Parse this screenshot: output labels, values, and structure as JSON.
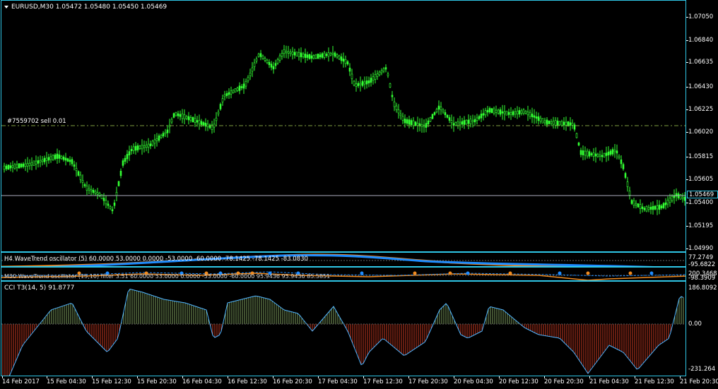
{
  "main": {
    "header": "EURUSD,M30  1.05472 1.05480 1.05450 1.05469",
    "order_line_label": "#7559702 sell 0.01",
    "current_price": "1.05469",
    "price_ticks": [
      "1.07050",
      "1.06840",
      "1.06635",
      "1.06430",
      "1.06225",
      "1.06020",
      "1.05815",
      "1.05605",
      "1.05400",
      "1.05195",
      "1.04990"
    ]
  },
  "wavetrend_h4": {
    "label": "H4 WaveTrend oscillator (5) 60.0000 53.0000 0.0000 -53.0000 -60.0000 -78.1425 -78.1425 -83.0830",
    "ticks": [
      "77.2749",
      "-95.6822"
    ]
  },
  "wavetrend_m30": {
    "label": "M30 WaveTrend oscillator (15,10) filter 3.51 60.0000 53.0000 0.0000 -53.0000 -60.0000 95.9436 95.9436 85.5851",
    "ticks": [
      "200.3468",
      "-98.3909"
    ]
  },
  "cci": {
    "label": "CCI T3(14, 5) 91.8777",
    "ticks": [
      "186.8092",
      "0.00",
      "-231.264"
    ]
  },
  "time_labels": [
    "14 Feb 2017",
    "15 Feb 04:30",
    "15 Feb 12:30",
    "15 Feb 20:30",
    "16 Feb 04:30",
    "16 Feb 12:30",
    "16 Feb 20:30",
    "17 Feb 04:30",
    "17 Feb 12:30",
    "17 Feb 20:30",
    "20 Feb 04:30",
    "20 Feb 12:30",
    "20 Feb 20:30",
    "21 Feb 04:30",
    "21 Feb 12:30",
    "21 Feb 20:30"
  ],
  "colors": {
    "frame": "#2fc6e6",
    "candle": "#32ff32",
    "cci_pos": "#7fa060",
    "cci_neg": "#c83a22",
    "wt_orange": "#f08a1e",
    "wt_blue": "#1e8cff"
  }
}
